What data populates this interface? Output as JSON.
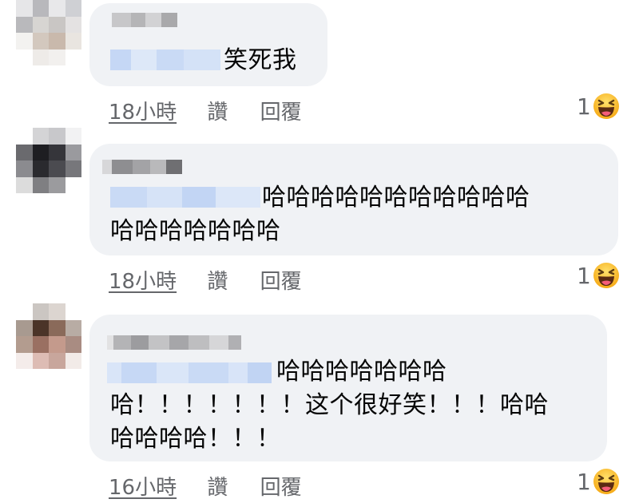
{
  "comments": [
    {
      "lines": [
        "笑死我"
      ],
      "time": "18小時",
      "like": "讚",
      "reply": "回覆",
      "reactions": {
        "count": "1",
        "icon": "haha-emoji-icon"
      }
    },
    {
      "lines": [
        "哈哈哈哈哈哈哈哈哈哈哈",
        "哈哈哈哈哈哈哈"
      ],
      "time": "18小時",
      "like": "讚",
      "reply": "回覆",
      "reactions": {
        "count": "1",
        "icon": "haha-emoji-icon"
      }
    },
    {
      "lines": [
        "哈哈哈哈哈哈哈",
        "哈！！！！！！！这个很好笑！！！哈哈",
        "哈哈哈哈！！！"
      ],
      "time": "16小時",
      "like": "讚",
      "reply": "回覆",
      "reactions": {
        "count": "1",
        "icon": "haha-emoji-icon"
      }
    }
  ],
  "colors": {
    "bubble": "#f0f2f5",
    "meta_text": "#65676b",
    "text": "#050505",
    "mention_blur": "#c5d7f5"
  }
}
